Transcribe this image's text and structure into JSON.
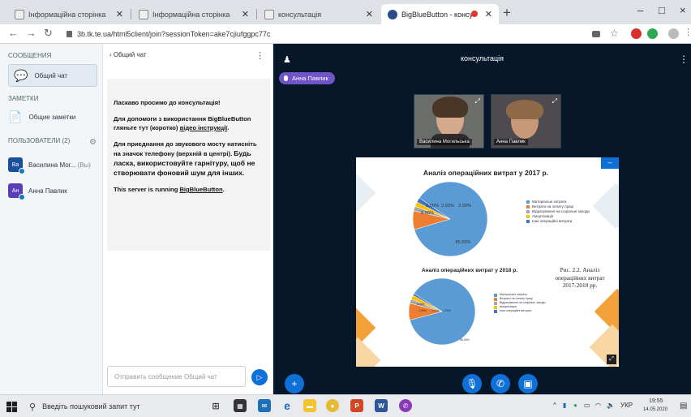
{
  "browser": {
    "tabs": [
      {
        "title": "Інформаційна сторінка",
        "active": false
      },
      {
        "title": "Інформаційна сторінка",
        "active": false
      },
      {
        "title": "консультація",
        "active": false
      },
      {
        "title": "BigBlueButton - консульта...",
        "active": true
      }
    ],
    "new_tab": "+",
    "window_controls": [
      "–",
      "□",
      "×"
    ],
    "url": "3b.tk.te.ua/html5client/join?sessionToken=ake7cjiufggpc77c"
  },
  "left_rail": {
    "messages_heading": "СООБЩЕНИЯ",
    "public_chat": "Общий чат",
    "notes_heading": "ЗАМЕТКИ",
    "shared_notes": "Общие заметки",
    "users_heading": "ПОЛЬЗОВАТЕЛИ (2)",
    "users": [
      {
        "initials": "Ва",
        "name": "Василина Мог...",
        "suffix": "(Вы)",
        "color": "#1b4e9b"
      },
      {
        "initials": "Ан",
        "name": "Анна Павлик",
        "suffix": "",
        "color": "#5b3fb8"
      }
    ]
  },
  "chat": {
    "header": "‹ Общий чат",
    "welcome_line1_prefix": "Ласкаво просимо до ",
    "welcome_line1_bold": "консультація",
    "welcome_line1_suffix": "!",
    "help_text": "Для допомоги з використання BigBlueButton гляньте тут (коротко) ",
    "help_link": "відео інструкції",
    "help_end": ".",
    "audio_text": "Для приєднання до звукового мосту натисніть на значок телефону (верхній в центрі). ",
    "audio_bold": "Будь ласка, використовуйте гарнітуру, щоб не створювати фоновий шум для інших.",
    "server_text": "This server is running ",
    "server_link": "BigBlueButton",
    "server_end": ".",
    "input_placeholder": "Отправить сообщение Общий чат"
  },
  "main": {
    "meeting_title": "консультація",
    "talking": "Анна Павлик",
    "videos": [
      {
        "name": "Василина Могильська"
      },
      {
        "name": "Анна Павлик"
      }
    ],
    "slide_caption": "Рис. 2.2. Аналіз операційних витрат 2017-2018 рр."
  },
  "chart_data": [
    {
      "type": "pie",
      "title": "Аналіз операційних витрат у 2017 р.",
      "labels": [
        "Матеріальні затрати",
        "Витрати на оплату праці",
        "Відрахування на соціальні заходи",
        "Амортизація",
        "Інші операційні витрати"
      ],
      "values": [
        85.0,
        8.0,
        2.0,
        2.0,
        2.0
      ],
      "value_labels": [
        "85.00%",
        "8.00%",
        "2.00%",
        "2.00%",
        "2.00%"
      ],
      "colors": [
        "#5b9bd5",
        "#ed7d31",
        "#a5a5a5",
        "#ffc000",
        "#4472c4"
      ],
      "legend": "right"
    },
    {
      "type": "pie",
      "title": "Аналіз операційних витрат у 2018 р.",
      "labels": [
        "Матеріальні затрати",
        "Витрати на оплату праці",
        "Відрахування на соціальні заходи",
        "Амортизація",
        "Інші операційні витрати"
      ],
      "values": [
        85.0,
        8.0,
        2.0,
        2.0,
        1.0
      ],
      "value_labels": [
        "85.00%",
        "8.00%",
        "2.00%",
        "2.00%",
        "1.00%"
      ],
      "colors": [
        "#5b9bd5",
        "#ed7d31",
        "#a5a5a5",
        "#ffc000",
        "#4472c4"
      ],
      "legend": "right"
    }
  ],
  "taskbar": {
    "search_placeholder": "Введіть пошуковий запит тут",
    "language": "УКР",
    "time": "19:55",
    "date": "14.05.2020"
  }
}
